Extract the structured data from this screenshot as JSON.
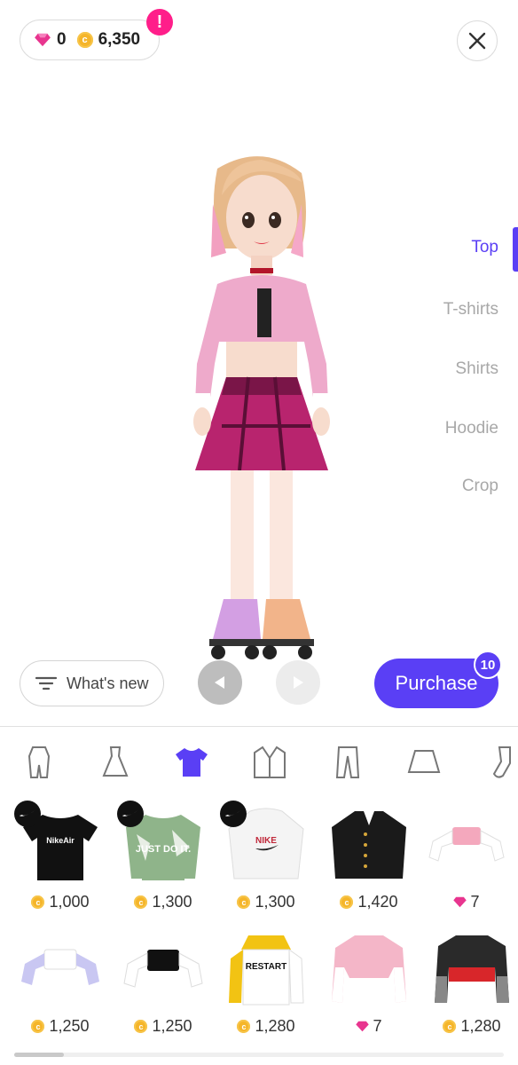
{
  "currency": {
    "gems": "0",
    "coins": "6,350",
    "alert": "!"
  },
  "categories": [
    {
      "label": "Top",
      "active": true
    },
    {
      "label": "T-shirts",
      "active": false
    },
    {
      "label": "Shirts",
      "active": false
    },
    {
      "label": "Hoodie",
      "active": false
    },
    {
      "label": "Crop",
      "active": false
    }
  ],
  "buttons": {
    "whats_new": "What's new",
    "purchase": "Purchase",
    "purchase_count": "10"
  },
  "category_icons": [
    "bodysuit-icon",
    "dress-icon",
    "tshirt-icon",
    "jacket-icon",
    "pants-icon",
    "skirt-icon",
    "sock-icon"
  ],
  "items": [
    {
      "name": "nike-air-tshirt",
      "price": "1,000",
      "currency": "coin",
      "brand": "nike",
      "print": "NikeAir"
    },
    {
      "name": "nike-camo-jacket",
      "price": "1,300",
      "currency": "coin",
      "brand": "nike",
      "print": "JUST DO IT."
    },
    {
      "name": "nike-white-hoodie",
      "price": "1,300",
      "currency": "coin",
      "brand": "nike",
      "print": "NIKE"
    },
    {
      "name": "black-military-jacket",
      "price": "1,420",
      "currency": "coin"
    },
    {
      "name": "pink-off-shoulder-top",
      "price": "7",
      "currency": "gem"
    },
    {
      "name": "lavender-off-shoulder-top",
      "price": "1,250",
      "currency": "coin"
    },
    {
      "name": "black-off-shoulder-top",
      "price": "1,250",
      "currency": "coin"
    },
    {
      "name": "restart-yellow-jacket",
      "price": "1,280",
      "currency": "coin",
      "print": "RESTART"
    },
    {
      "name": "pink-crop-jersey",
      "price": "7",
      "currency": "gem"
    },
    {
      "name": "black-red-jersey",
      "price": "1,280",
      "currency": "coin"
    }
  ],
  "colors": {
    "accent": "#5a3ff5",
    "alert": "#ff1e8a",
    "coin": "#f5b52a",
    "gem": "#e8358f"
  }
}
